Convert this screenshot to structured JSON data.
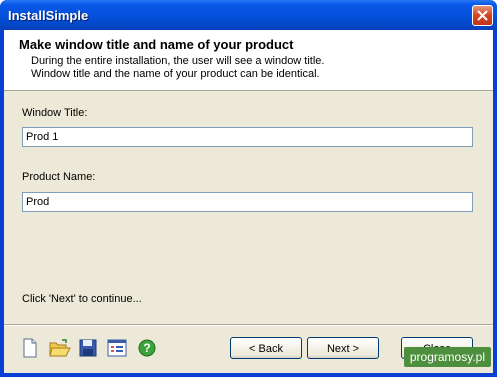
{
  "window": {
    "title": "InstallSimple"
  },
  "header": {
    "title": "Make window title and name of your product",
    "desc_line1": "During the entire installation, the user will see a window title.",
    "desc_line2": "Window title and the name of your product can be identical."
  },
  "form": {
    "window_title_label": "Window Title:",
    "window_title_value": "Prod 1",
    "product_name_label": "Product Name:",
    "product_name_value": "Prod"
  },
  "hint": "Click 'Next' to continue...",
  "toolbar": {
    "icons": [
      "new-document-icon",
      "open-folder-icon",
      "save-disk-icon",
      "list-settings-icon",
      "help-icon"
    ]
  },
  "buttons": {
    "back": "< Back",
    "next": "Next >",
    "close": "Close"
  },
  "watermark": "programosy.pl"
}
